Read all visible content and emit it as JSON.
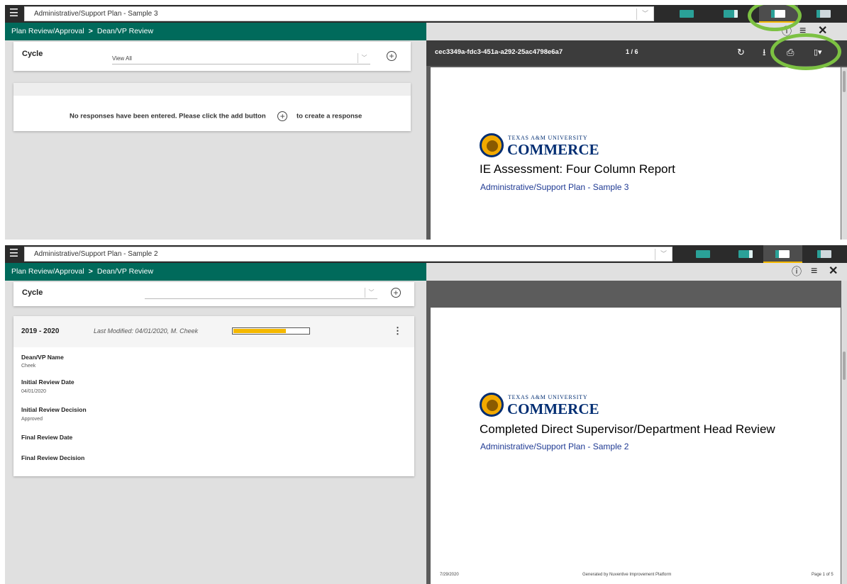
{
  "shots": [
    {
      "topbar": {
        "menu_icon": "hamburger-menu-icon",
        "title": "Administrative/Support Plan - Sample 3",
        "view_icons": [
          "full-view-icon",
          "split-view-icon",
          "half-view-icon",
          "document-view-icon"
        ],
        "active_view_index": 2
      },
      "breadcrumb": {
        "parent": "Plan Review/Approval",
        "separator": ">",
        "current": "Dean/VP Review"
      },
      "panel_icons": [
        "info-icon",
        "list-icon",
        "close-icon"
      ],
      "cycle": {
        "label": "Cycle",
        "value": "View All"
      },
      "empty_message": {
        "before": "No responses have been entered. Please click the add button",
        "after": "to create a response"
      },
      "pdf": {
        "document_id": "cec3349a-fdc3-451a-a292-25ac4798e6a7",
        "page_indicator": "1 / 6",
        "toolbar_icons": [
          "rotate-icon",
          "download-icon",
          "print-icon",
          "bookmark-icon"
        ],
        "logo": {
          "small": "TEXAS A&M UNIVERSITY",
          "big": "COMMERCE"
        },
        "title": "IE Assessment: Four Column Report",
        "subtitle": "Administrative/Support Plan - Sample 3"
      },
      "highlight_color": "#7cc142"
    },
    {
      "topbar": {
        "menu_icon": "hamburger-menu-icon",
        "title": "Administrative/Support Plan - Sample 2",
        "view_icons": [
          "full-view-icon",
          "split-view-icon",
          "half-view-icon",
          "document-view-icon"
        ],
        "active_view_index": 2
      },
      "breadcrumb": {
        "parent": "Plan Review/Approval",
        "separator": ">",
        "current": "Dean/VP Review"
      },
      "panel_icons": [
        "info-icon",
        "list-icon",
        "close-icon"
      ],
      "cycle": {
        "label": "Cycle",
        "value": ""
      },
      "entry": {
        "year": "2019 - 2020",
        "last_modified": "Last Modified: 04/01/2020, M. Cheek",
        "progress": 0.7,
        "fields": [
          {
            "label": "Dean/VP Name",
            "value": "Cheek"
          },
          {
            "label": "Initial Review Date",
            "value": "04/01/2020"
          },
          {
            "label": "Initial Review Decision",
            "value": "Approved"
          },
          {
            "label": "Final Review Date",
            "value": ""
          },
          {
            "label": "Final Review Decision",
            "value": ""
          }
        ]
      },
      "pdf": {
        "logo": {
          "small": "TEXAS A&M UNIVERSITY",
          "big": "COMMERCE"
        },
        "title": "Completed Direct Supervisor/Department Head Review",
        "subtitle": "Administrative/Support Plan - Sample 2",
        "footer": {
          "date": "7/29/2020",
          "generated": "Generated by Nuventive Improvement Platform",
          "page": "Page 1 of 5"
        }
      }
    }
  ],
  "colors": {
    "header_bg": "#2b2b2b",
    "breadcrumb_bg": "#006a5b",
    "accent": "#f5b800",
    "view_icon": "#2aa198",
    "logo_navy": "#002d72",
    "logo_gold": "#f2a900"
  }
}
